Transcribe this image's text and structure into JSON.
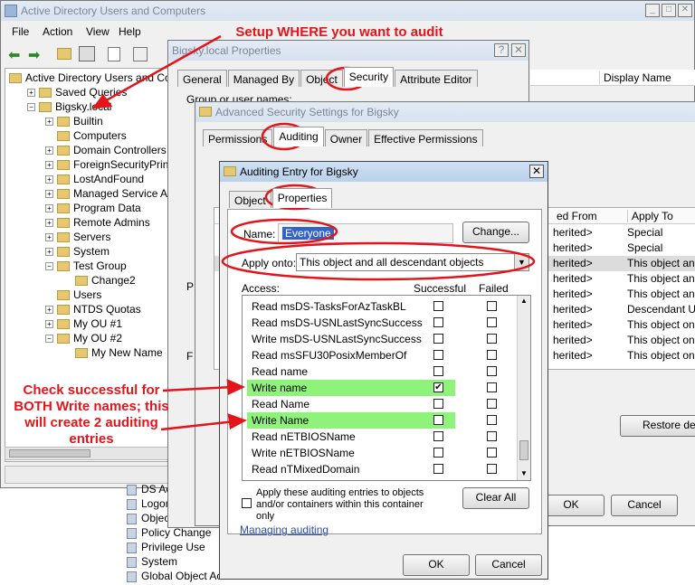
{
  "main_window": {
    "title": "Active Directory Users and Computers",
    "menu": [
      "File",
      "Action",
      "View",
      "Help"
    ],
    "tree": [
      {
        "label": "Active Directory Users and Com",
        "level": 0
      },
      {
        "label": "Saved Queries",
        "level": 1
      },
      {
        "label": "Bigsky.local",
        "level": 1
      },
      {
        "label": "Builtin",
        "level": 2
      },
      {
        "label": "Computers",
        "level": 2
      },
      {
        "label": "Domain Controllers",
        "level": 2
      },
      {
        "label": "ForeignSecurityPrincipal",
        "level": 2
      },
      {
        "label": "LostAndFound",
        "level": 2
      },
      {
        "label": "Managed Service Accou",
        "level": 2
      },
      {
        "label": "Program Data",
        "level": 2
      },
      {
        "label": "Remote Admins",
        "level": 2
      },
      {
        "label": "Servers",
        "level": 2
      },
      {
        "label": "System",
        "level": 2
      },
      {
        "label": "Test Group",
        "level": 2
      },
      {
        "label": "Change2",
        "level": 3
      },
      {
        "label": "Users",
        "level": 2
      },
      {
        "label": "NTDS Quotas",
        "level": 2
      },
      {
        "label": "My OU #1",
        "level": 2
      },
      {
        "label": "My OU #2",
        "level": 2
      },
      {
        "label": "My New Name",
        "level": 3
      }
    ],
    "column_header": "Display Name"
  },
  "bottom_list": [
    "DS Access",
    "Logon/Logo",
    "Object Acce",
    "Policy Change",
    "Privilege Use",
    "System",
    "Global Object Acc"
  ],
  "properties_dialog": {
    "title": "Bigsky.local Properties",
    "tabs": [
      "General",
      "Managed By",
      "Object",
      "Security",
      "Attribute Editor"
    ],
    "group_label": "Group or user names:"
  },
  "advanced_dialog": {
    "title": "Advanced Security Settings for Bigsky",
    "tabs": [
      "Permissions",
      "Auditing",
      "Owner",
      "Effective Permissions"
    ],
    "col_inherited": "ed From",
    "col_apply": "Apply To",
    "rows": [
      {
        "from": "herited>",
        "to": "Special"
      },
      {
        "from": "herited>",
        "to": "Special"
      },
      {
        "from": "herited>",
        "to": "This object and a"
      },
      {
        "from": "herited>",
        "to": "This object and a"
      },
      {
        "from": "herited>",
        "to": "This object and a"
      },
      {
        "from": "herited>",
        "to": "Descendant Use"
      },
      {
        "from": "herited>",
        "to": "This object only"
      },
      {
        "from": "herited>",
        "to": "This object only"
      },
      {
        "from": "herited>",
        "to": "This object only"
      }
    ],
    "restore_button": "Restore defa",
    "ok": "OK",
    "cancel": "Cancel"
  },
  "audit_dialog": {
    "title": "Auditing Entry for Bigsky",
    "tabs": [
      "Object",
      "Properties"
    ],
    "name_label": "Name:",
    "name_value": "Everyone",
    "change_button": "Change...",
    "apply_label": "Apply onto:",
    "apply_value": "This object and all descendant objects",
    "access_header": "Access:",
    "successful_header": "Successful",
    "failed_header": "Failed",
    "entries": [
      {
        "label": "Read msDS-TasksForAzTaskBL",
        "s": false,
        "f": false
      },
      {
        "label": "Read msDS-USNLastSyncSuccess",
        "s": false,
        "f": false
      },
      {
        "label": "Write msDS-USNLastSyncSuccess",
        "s": false,
        "f": false
      },
      {
        "label": "Read msSFU30PosixMemberOf",
        "s": false,
        "f": false
      },
      {
        "label": "Read name",
        "s": false,
        "f": false
      },
      {
        "label": "Write name",
        "s": true,
        "f": false
      },
      {
        "label": "Read Name",
        "s": false,
        "f": false
      },
      {
        "label": "Write Name",
        "s": false,
        "f": false
      },
      {
        "label": "Read nETBIOSName",
        "s": false,
        "f": false
      },
      {
        "label": "Write nETBIOSName",
        "s": false,
        "f": false
      },
      {
        "label": "Read nTMixedDomain",
        "s": false,
        "f": false
      }
    ],
    "apply_checkbox_label": "Apply these auditing entries to objects and/or containers within this container only",
    "clear_all": "Clear All",
    "managing_link": "Managing auditing",
    "ok": "OK",
    "cancel": "Cancel"
  },
  "annotations": {
    "top": "Setup WHERE you want to audit",
    "left": "Check successful for BOTH Write names; this will create 2 auditing entries"
  }
}
